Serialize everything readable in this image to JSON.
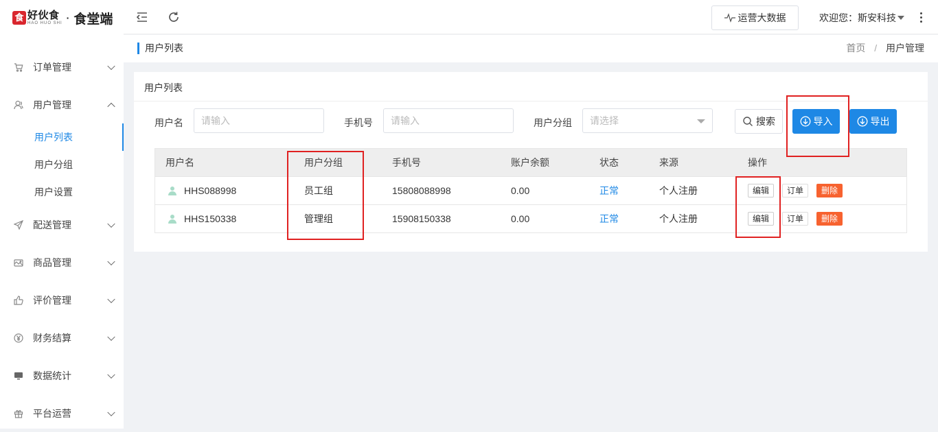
{
  "logo": {
    "mark": "食",
    "brand": "好伙食",
    "brand_pinyin": "HAO HUO SHI",
    "separator": "·",
    "subtitle": "食堂端"
  },
  "sidebar": {
    "items": [
      {
        "label": "订单管理",
        "icon": "cart-icon",
        "expanded": false
      },
      {
        "label": "用户管理",
        "icon": "user-icon",
        "expanded": true,
        "children": [
          {
            "label": "用户列表",
            "active": true
          },
          {
            "label": "用户分组",
            "active": false
          },
          {
            "label": "用户设置",
            "active": false
          }
        ]
      },
      {
        "label": "配送管理",
        "icon": "send-icon",
        "expanded": false
      },
      {
        "label": "商品管理",
        "icon": "goods-icon",
        "expanded": false
      },
      {
        "label": "评价管理",
        "icon": "thumb-icon",
        "expanded": false
      },
      {
        "label": "财务结算",
        "icon": "yen-icon",
        "expanded": false
      },
      {
        "label": "数据统计",
        "icon": "monitor-icon",
        "expanded": false
      },
      {
        "label": "平台运营",
        "icon": "gift-icon",
        "expanded": false
      }
    ]
  },
  "header": {
    "bigdata_label": "运营大数据",
    "welcome_label": "欢迎您：斯安科技"
  },
  "breadcrumb": {
    "page_title": "用户列表",
    "items": [
      "首页",
      "用户管理"
    ],
    "separator": "/"
  },
  "card": {
    "title": "用户列表",
    "filters": {
      "username_label": "用户名",
      "username_placeholder": "请输入",
      "phone_label": "手机号",
      "phone_placeholder": "请输入",
      "group_label": "用户分组",
      "group_placeholder": "请选择"
    },
    "buttons": {
      "search": "搜索",
      "import": "导入",
      "export": "导出"
    }
  },
  "table": {
    "columns": [
      "用户名",
      "用户分组",
      "手机号",
      "账户余额",
      "状态",
      "来源",
      "操作"
    ],
    "rows": [
      {
        "username": "HHS088998",
        "group": "员工组",
        "phone": "15808088998",
        "balance": "0.00",
        "status": "正常",
        "source": "个人注册"
      },
      {
        "username": "HHS150338",
        "group": "管理组",
        "phone": "15908150338",
        "balance": "0.00",
        "status": "正常",
        "source": "个人注册"
      }
    ],
    "actions": {
      "edit": "编辑",
      "order": "订单",
      "delete": "删除"
    }
  },
  "colors": {
    "accent": "#1e88e5",
    "danger": "#f7622f",
    "brand": "#d9272e",
    "highlight": "#e02020"
  }
}
